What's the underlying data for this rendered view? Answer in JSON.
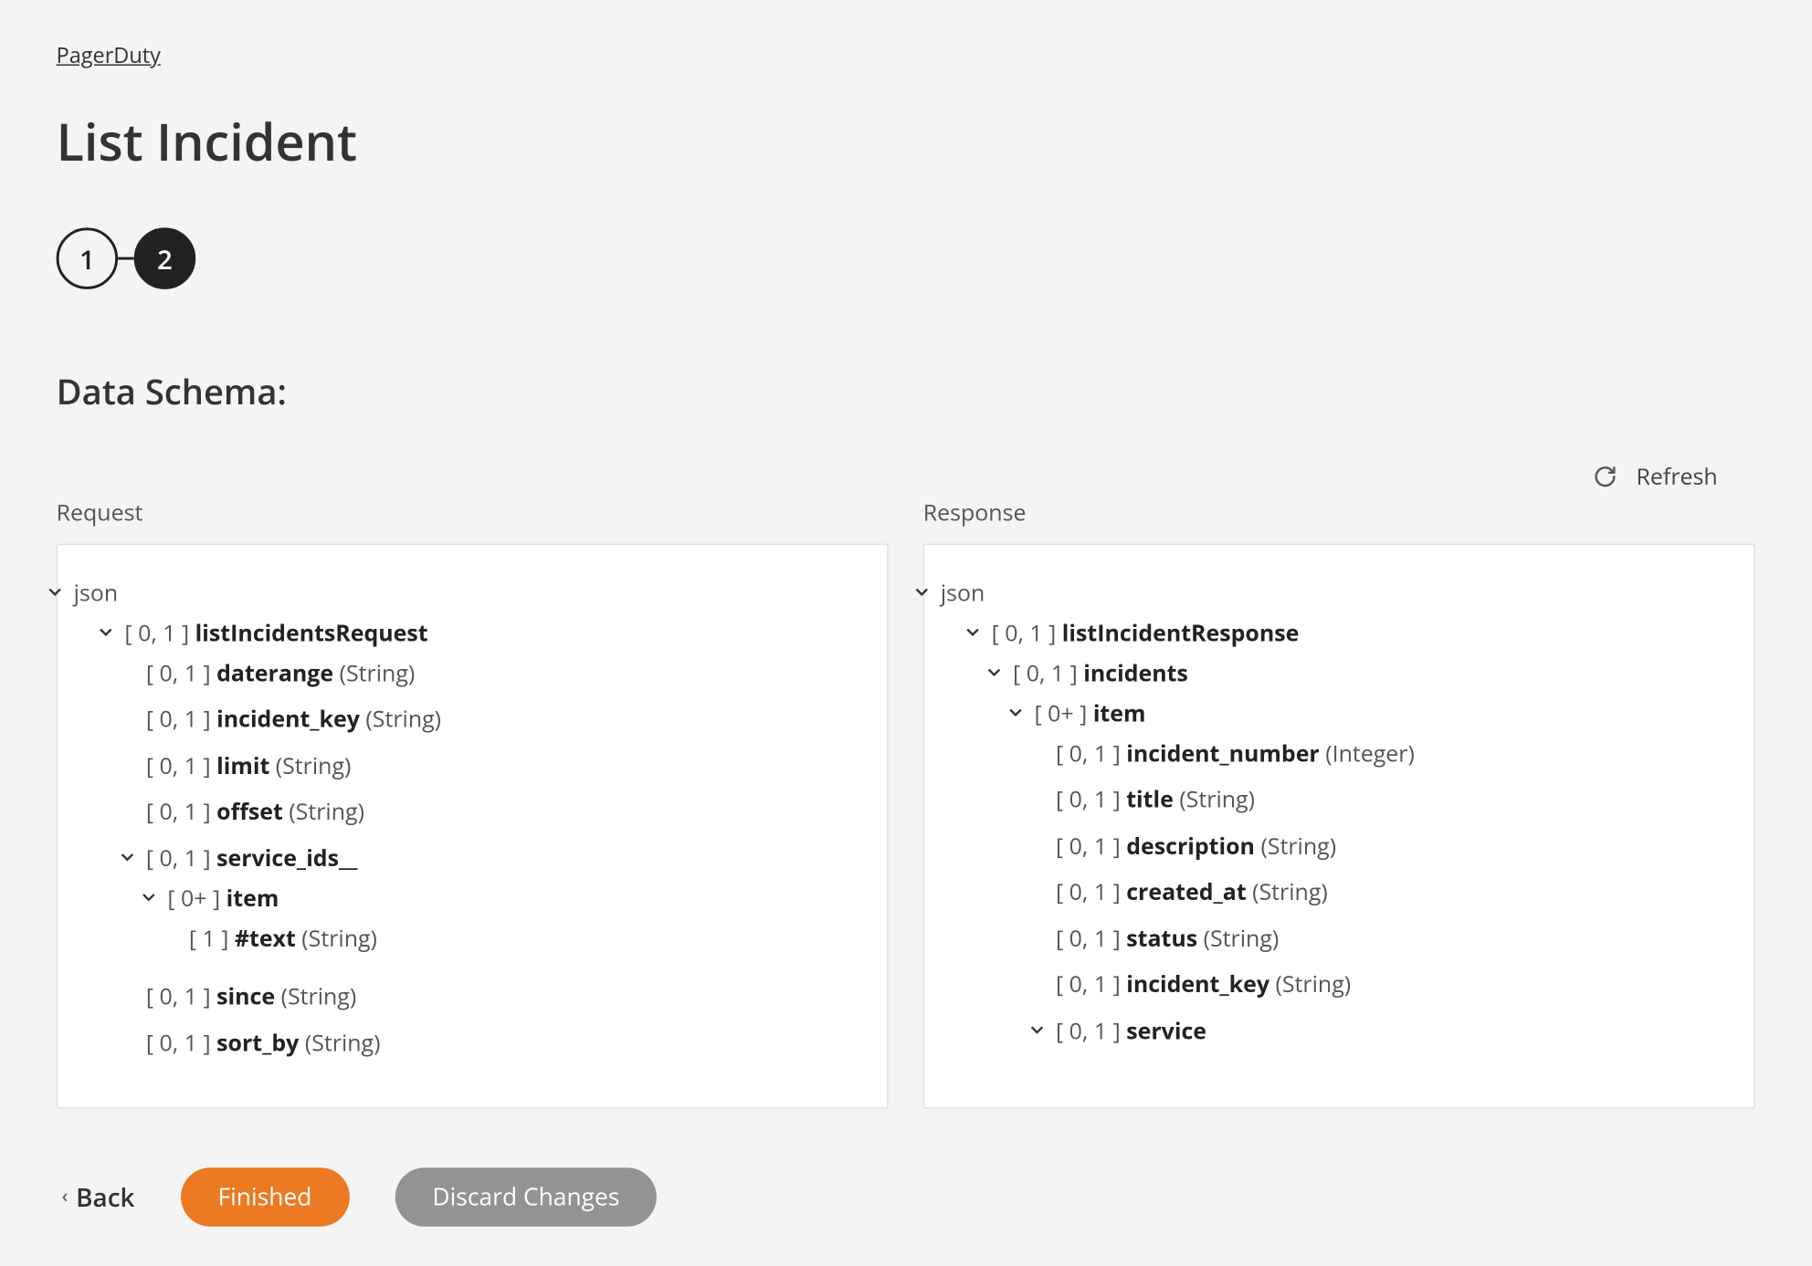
{
  "breadcrumb": "PagerDuty",
  "page_title": "List Incident",
  "stepper": {
    "step1": "1",
    "step2": "2"
  },
  "section_title": "Data Schema:",
  "refresh_label": "Refresh",
  "columns": {
    "request_label": "Request",
    "response_label": "Response"
  },
  "tree_root_label": "json",
  "request_tree": {
    "root": {
      "card": "[ 0, 1 ]",
      "name": "listIncidentsRequest"
    },
    "children": [
      {
        "card": "[ 0, 1 ]",
        "name": "daterange",
        "type": "(String)"
      },
      {
        "card": "[ 0, 1 ]",
        "name": "incident_key",
        "type": "(String)"
      },
      {
        "card": "[ 0, 1 ]",
        "name": "limit",
        "type": "(String)"
      },
      {
        "card": "[ 0, 1 ]",
        "name": "offset",
        "type": "(String)"
      }
    ],
    "service_ids": {
      "card": "[ 0, 1 ]",
      "name": "service_ids__",
      "item": {
        "card": "[ 0+ ]",
        "name": "item",
        "text": {
          "card": "[ 1 ]",
          "name": "#text",
          "type": "(String)"
        }
      }
    },
    "tail": [
      {
        "card": "[ 0, 1 ]",
        "name": "since",
        "type": "(String)"
      },
      {
        "card": "[ 0, 1 ]",
        "name": "sort_by",
        "type": "(String)"
      }
    ]
  },
  "response_tree": {
    "root": {
      "card": "[ 0, 1 ]",
      "name": "listIncidentResponse"
    },
    "incidents": {
      "card": "[ 0, 1 ]",
      "name": "incidents"
    },
    "item": {
      "card": "[ 0+ ]",
      "name": "item"
    },
    "item_children": [
      {
        "card": "[ 0, 1 ]",
        "name": "incident_number",
        "type": "(Integer)"
      },
      {
        "card": "[ 0, 1 ]",
        "name": "title",
        "type": "(String)"
      },
      {
        "card": "[ 0, 1 ]",
        "name": "description",
        "type": "(String)"
      },
      {
        "card": "[ 0, 1 ]",
        "name": "created_at",
        "type": "(String)"
      },
      {
        "card": "[ 0, 1 ]",
        "name": "status",
        "type": "(String)"
      },
      {
        "card": "[ 0, 1 ]",
        "name": "incident_key",
        "type": "(String)"
      }
    ],
    "service": {
      "card": "[ 0, 1 ]",
      "name": "service"
    }
  },
  "footer": {
    "back": "Back",
    "finished": "Finished",
    "discard": "Discard Changes"
  }
}
